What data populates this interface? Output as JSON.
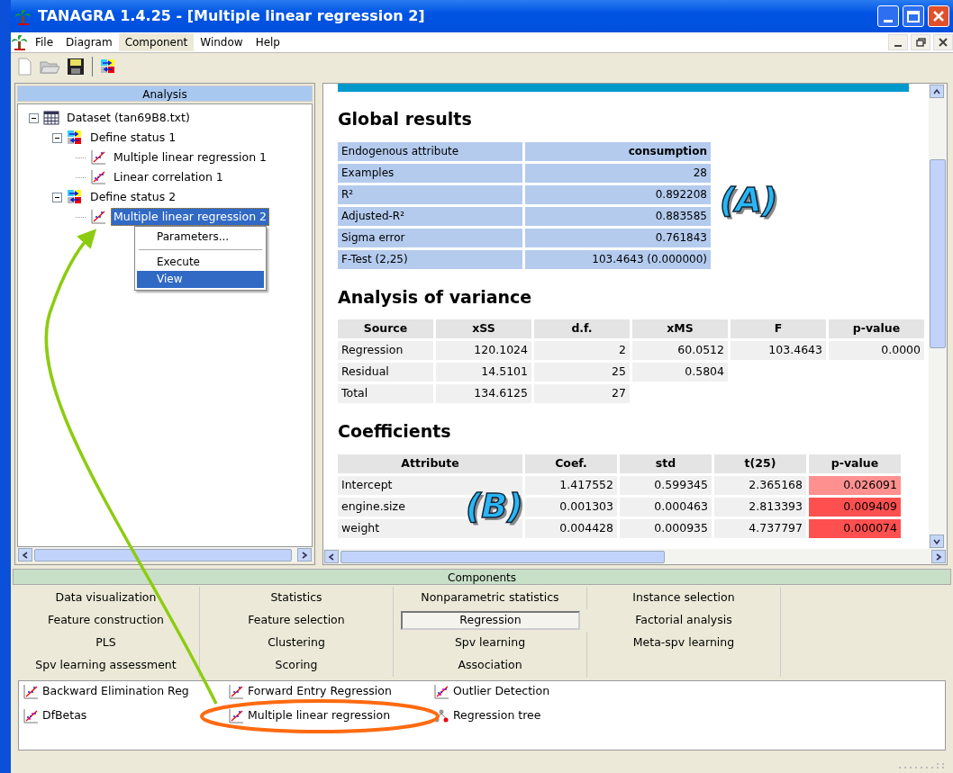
{
  "window": {
    "title": "TANAGRA 1.4.25 - [Multiple linear regression 2]"
  },
  "menu": [
    {
      "label": "File",
      "selected": false
    },
    {
      "label": "Diagram",
      "selected": false
    },
    {
      "label": "Component",
      "selected": true
    },
    {
      "label": "Window",
      "selected": false
    },
    {
      "label": "Help",
      "selected": false
    }
  ],
  "analysis": {
    "title": "Analysis",
    "tree": [
      {
        "label": "Dataset (tan69B8.txt)",
        "kind": "dataset",
        "expanded": true,
        "selected": false,
        "children": [
          {
            "label": "Define status 1",
            "kind": "status",
            "expanded": true,
            "selected": false,
            "children": [
              {
                "label": "Multiple linear regression 1",
                "kind": "regression",
                "selected": false
              },
              {
                "label": "Linear correlation 1",
                "kind": "correlation",
                "selected": false
              }
            ]
          },
          {
            "label": "Define status 2",
            "kind": "status",
            "expanded": true,
            "selected": false,
            "children": [
              {
                "label": "Multiple linear regression 2",
                "kind": "regression",
                "selected": true
              }
            ]
          }
        ]
      }
    ]
  },
  "context_menu": [
    {
      "kind": "item",
      "label": "Parameters...",
      "selected": false
    },
    {
      "kind": "separator"
    },
    {
      "kind": "item",
      "label": "Execute",
      "selected": false
    },
    {
      "kind": "item",
      "label": "View",
      "selected": true
    }
  ],
  "results": [
    {
      "kind": "kv",
      "title": "Global results",
      "rows": [
        [
          "Endogenous attribute",
          "consumption"
        ],
        [
          "Examples",
          "28"
        ],
        [
          "R²",
          "0.892208"
        ],
        [
          "Adjusted-R²",
          "0.883585"
        ],
        [
          "Sigma error",
          "0.761843"
        ],
        [
          "F-Test (2,25)",
          "103.4643 (0.000000)"
        ]
      ]
    },
    {
      "kind": "table",
      "title": "Analysis of variance",
      "columns": [
        "Source",
        "xSS",
        "d.f.",
        "xMS",
        "F",
        "p-value"
      ],
      "rows": [
        {
          "cells": [
            "Regression",
            "120.1024",
            "2",
            "60.0512",
            "103.4643",
            "0.0000"
          ]
        },
        {
          "cells": [
            "Residual",
            "14.5101",
            "25",
            "0.5804"
          ]
        },
        {
          "cells": [
            "Total",
            "134.6125",
            "27"
          ]
        }
      ]
    },
    {
      "kind": "table",
      "title": "Coefficients",
      "columns": [
        "Attribute",
        "Coef.",
        "std",
        "t(25)",
        "p-value"
      ],
      "rows": [
        {
          "cells": [
            "Intercept",
            "1.417552",
            "0.599345",
            "2.365168",
            "0.026091"
          ],
          "color": "#ff9090"
        },
        {
          "cells": [
            "engine.size",
            "0.001303",
            "0.000463",
            "2.813393",
            "0.009409"
          ],
          "color": "#ff5050"
        },
        {
          "cells": [
            "weight",
            "0.004428",
            "0.000935",
            "4.737797",
            "0.000074"
          ],
          "color": "#ff5050"
        }
      ]
    }
  ],
  "annotations": [
    {
      "label": "(A)"
    },
    {
      "label": "(B)"
    }
  ],
  "components": {
    "title": "Components",
    "tabs": [
      [
        {
          "label": "Data visualization",
          "selected": false
        },
        {
          "label": "Statistics",
          "selected": false
        },
        {
          "label": "Nonparametric statistics",
          "selected": false
        },
        {
          "label": "Instance selection",
          "selected": false
        }
      ],
      [
        {
          "label": "Feature construction",
          "selected": false
        },
        {
          "label": "Feature selection",
          "selected": false
        },
        {
          "label": "Regression",
          "selected": true
        },
        {
          "label": "Factorial analysis",
          "selected": false
        }
      ],
      [
        {
          "label": "PLS",
          "selected": false
        },
        {
          "label": "Clustering",
          "selected": false
        },
        {
          "label": "Spv learning",
          "selected": false
        },
        {
          "label": "Meta-spv learning",
          "selected": false
        }
      ],
      [
        {
          "label": "Spv learning assessment",
          "selected": false
        },
        {
          "label": "Scoring",
          "selected": false
        },
        {
          "label": "Association",
          "selected": false
        }
      ]
    ],
    "items": [
      {
        "label": "Backward Elimination Reg"
      },
      {
        "label": "DfBetas"
      },
      {
        "label": "Forward Entry Regression"
      },
      {
        "label": "Multiple linear regression"
      },
      {
        "label": "Outlier Detection"
      },
      {
        "label": "Regression tree"
      }
    ]
  }
}
